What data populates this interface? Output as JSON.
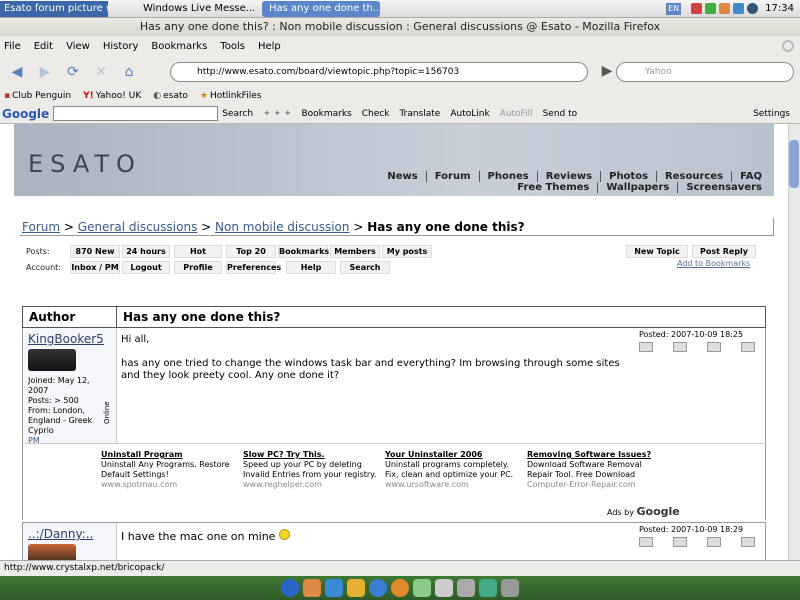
{
  "taskbar": {
    "tasks": [
      {
        "label": "Esato forum picture www.esato.com"
      },
      {
        "label": "Windows Live Messe..."
      },
      {
        "label": "Has any one done th..."
      }
    ],
    "lang": "EN",
    "time": "17:34"
  },
  "window": {
    "title": "Has any one done this? : Non mobile discussion : General discussions @ Esato - Mozilla Firefox"
  },
  "menu": [
    "File",
    "Edit",
    "View",
    "History",
    "Bookmarks",
    "Tools",
    "Help"
  ],
  "nav": {
    "url": "http://www.esato.com/board/viewtopic.php?topic=156703",
    "search_placeholder": "Yahoo"
  },
  "bookmarks": [
    "Club Penguin",
    "Yahoo! UK",
    "esato",
    "HotlinkFiles"
  ],
  "google_toolbar": {
    "logo": "Google",
    "items": [
      "Search",
      "Bookmarks",
      "Check",
      "Translate",
      "AutoLink",
      "AutoFill",
      "Send to",
      "Settings"
    ]
  },
  "site": {
    "logo": "ESATO",
    "nav_row1": [
      "News",
      "Forum",
      "Phones",
      "Reviews",
      "Photos",
      "Resources",
      "FAQ"
    ],
    "nav_row2": [
      "Free Themes",
      "Wallpapers",
      "Screensavers"
    ]
  },
  "breadcrumb": {
    "forum": "Forum",
    "general": "General discussions",
    "nonmobile": "Non mobile discussion",
    "topic": "Has any one done this?",
    "sep": ">"
  },
  "controls": {
    "posts_label": "Posts:",
    "account_label": "Account:",
    "posts": [
      "870 New",
      "24 hours",
      "Hot",
      "Top 20",
      "Bookmarks",
      "Members",
      "My posts"
    ],
    "account": [
      "Inbox / PM",
      "Logout",
      "Profile",
      "Preferences",
      "Help",
      "Search"
    ],
    "new_topic": "New Topic",
    "post_reply": "Post Reply",
    "add_bookmarks": "Add to Bookmarks"
  },
  "thread": {
    "author_header": "Author",
    "title": "Has any one done this?"
  },
  "posts": [
    {
      "author": "KingBooker5",
      "joined": "Joined: May 12, 2007",
      "posts": "Posts: > 500",
      "from": "From: London, England - Greek Cyprio",
      "pm": "PM",
      "online": "Online",
      "date": "Posted: 2007-10-09 18:25",
      "greeting": "Hi all,",
      "body": "has any one tried to change the windows task bar and everything? Im browsing through some sites and they look preety cool. Any one done it?"
    },
    {
      "author": "..:/Danny:..",
      "date": "Posted: 2007-10-09 18:29",
      "body": "I have the mac one on mine"
    }
  ],
  "ads": [
    {
      "title": "Uninstall Program",
      "text": "Uninstall Any Programs. Restore Default Settings!",
      "url": "www.spotmau.com"
    },
    {
      "title": "Slow PC? Try This.",
      "text": "Speed up your PC by deleting Invalid Entries from your registry.",
      "url": "www.reghelper.com"
    },
    {
      "title": "Your Uninstaller 2006",
      "text": "Uninstall programs completely. Fix, clean and optimize your PC.",
      "url": "www.ursoftware.com"
    },
    {
      "title": "Removing Software Issues?",
      "text": "Download Software Removal Repair Tool. Free Download",
      "url": "Computer-Error-Repair.com"
    }
  ],
  "ads_by": {
    "prefix": "Ads by",
    "brand": "Google"
  },
  "status": "http://www.crystalxp.net/bricopack/"
}
